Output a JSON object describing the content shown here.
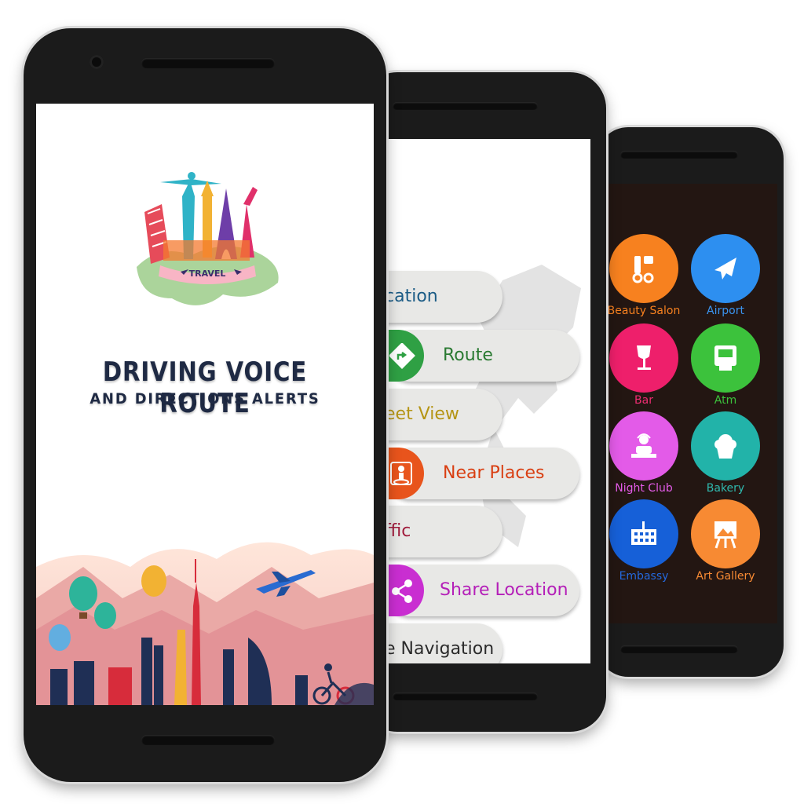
{
  "splash": {
    "logo_banner": "TRAVEL",
    "title_line1": "DRIVING VOICE ROUTE",
    "title_line2": "AND DIRECTIONS ALERTS"
  },
  "menu": {
    "items": [
      {
        "label": "cation",
        "color": "#1c5c86"
      },
      {
        "label": "Route",
        "color": "#2a7a32",
        "icon": "direction-sign-icon",
        "icon_color": "#2fa044"
      },
      {
        "label": "eet View",
        "color": "#b59515"
      },
      {
        "label": "Near Places",
        "color": "#d93f12",
        "icon": "person-pin-icon",
        "icon_color": "#e8541c"
      },
      {
        "label": "ffic",
        "color": "#a01c3c"
      },
      {
        "label": "Share Location",
        "color": "#b41fb8",
        "icon": "share-icon",
        "icon_color": "#c92ed1"
      },
      {
        "label": "e Navigation",
        "color": "#2b2b2b"
      }
    ]
  },
  "categories": [
    {
      "label": "Beauty Salon",
      "color": "#f7811f",
      "text_color": "#f7811f",
      "icon": "salon-icon"
    },
    {
      "label": "Airport",
      "color": "#2d8ff0",
      "text_color": "#3a94f0",
      "icon": "airplane-icon"
    },
    {
      "label": "Bar",
      "color": "#ee1f6b",
      "text_color": "#ee2d72",
      "icon": "wine-glass-icon"
    },
    {
      "label": "Atm",
      "color": "#3cc23c",
      "text_color": "#3cc23c",
      "icon": "atm-icon"
    },
    {
      "label": "Night Club",
      "color": "#e35be8",
      "text_color": "#e35be8",
      "icon": "dj-icon"
    },
    {
      "label": "Bakery",
      "color": "#22b3a9",
      "text_color": "#2fb8ad",
      "icon": "cupcake-icon"
    },
    {
      "label": "Embassy",
      "color": "#1660d8",
      "text_color": "#2468dc",
      "icon": "building-icon"
    },
    {
      "label": "Art Gallery",
      "color": "#f78a33",
      "text_color": "#f78a33",
      "icon": "easel-icon"
    }
  ]
}
